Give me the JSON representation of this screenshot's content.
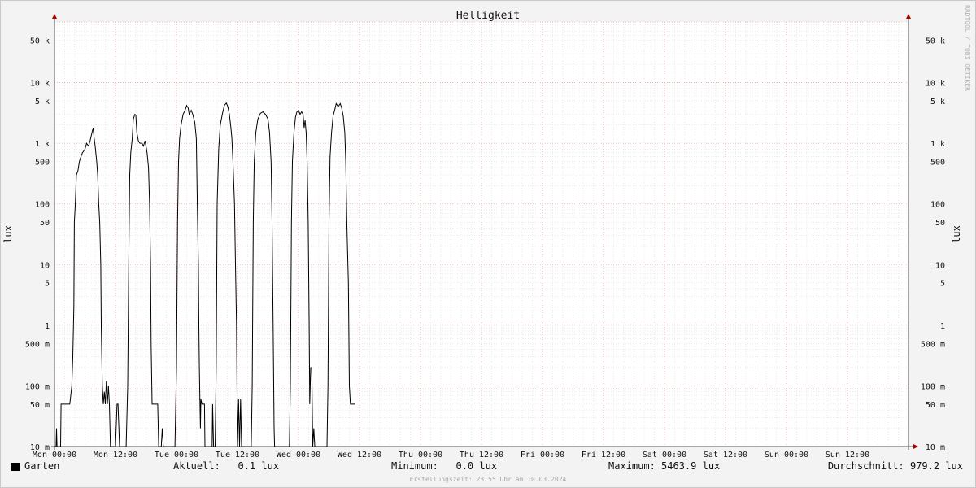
{
  "chart_data": {
    "type": "line",
    "title": "Helligkeit",
    "ylabel": "lux",
    "yscale": "log",
    "ylim": [
      0.01,
      100000
    ],
    "y_ticks": [
      {
        "value": 0.01,
        "label": "10 m"
      },
      {
        "value": 0.05,
        "label": "50 m"
      },
      {
        "value": 0.1,
        "label": "100 m"
      },
      {
        "value": 0.5,
        "label": "500 m"
      },
      {
        "value": 1,
        "label": "1"
      },
      {
        "value": 5,
        "label": "5"
      },
      {
        "value": 10,
        "label": "10"
      },
      {
        "value": 50,
        "label": "50"
      },
      {
        "value": 100,
        "label": "100"
      },
      {
        "value": 500,
        "label": "500"
      },
      {
        "value": 1000,
        "label": "1 k"
      },
      {
        "value": 5000,
        "label": "5 k"
      },
      {
        "value": 10000,
        "label": "10 k"
      },
      {
        "value": 50000,
        "label": "50 k"
      }
    ],
    "xlim_hours": [
      0,
      168
    ],
    "x_ticks": [
      {
        "hour": 0,
        "label": "Mon 00:00"
      },
      {
        "hour": 12,
        "label": "Mon 12:00"
      },
      {
        "hour": 24,
        "label": "Tue 00:00"
      },
      {
        "hour": 36,
        "label": "Tue 12:00"
      },
      {
        "hour": 48,
        "label": "Wed 00:00"
      },
      {
        "hour": 60,
        "label": "Wed 12:00"
      },
      {
        "hour": 72,
        "label": "Thu 00:00"
      },
      {
        "hour": 84,
        "label": "Thu 12:00"
      },
      {
        "hour": 96,
        "label": "Fri 00:00"
      },
      {
        "hour": 108,
        "label": "Fri 12:00"
      },
      {
        "hour": 120,
        "label": "Sat 00:00"
      },
      {
        "hour": 132,
        "label": "Sat 12:00"
      },
      {
        "hour": 144,
        "label": "Sun 00:00"
      },
      {
        "hour": 156,
        "label": "Sun 12:00"
      }
    ],
    "grid": true,
    "series": [
      {
        "name": "Garten",
        "color": "#000000",
        "points": [
          [
            0,
            0.01
          ],
          [
            0.3,
            0.01
          ],
          [
            0.4,
            0.02
          ],
          [
            0.5,
            0.01
          ],
          [
            1.2,
            0.01
          ],
          [
            1.3,
            0.05
          ],
          [
            3.0,
            0.05
          ],
          [
            3.2,
            0.07
          ],
          [
            3.4,
            0.1
          ],
          [
            3.6,
            0.3
          ],
          [
            3.8,
            2
          ],
          [
            3.9,
            50
          ],
          [
            4.1,
            100
          ],
          [
            4.3,
            300
          ],
          [
            4.6,
            350
          ],
          [
            4.9,
            500
          ],
          [
            5.2,
            600
          ],
          [
            5.5,
            700
          ],
          [
            6.0,
            800
          ],
          [
            6.3,
            1000
          ],
          [
            6.7,
            900
          ],
          [
            7.0,
            1100
          ],
          [
            7.3,
            1400
          ],
          [
            7.6,
            1800
          ],
          [
            7.8,
            1200
          ],
          [
            8.0,
            900
          ],
          [
            8.3,
            500
          ],
          [
            8.5,
            300
          ],
          [
            8.7,
            100
          ],
          [
            8.9,
            50
          ],
          [
            9.1,
            10
          ],
          [
            9.2,
            1
          ],
          [
            9.4,
            0.1
          ],
          [
            9.6,
            0.05
          ],
          [
            9.8,
            0.08
          ],
          [
            10.0,
            0.05
          ],
          [
            10.2,
            0.12
          ],
          [
            10.4,
            0.05
          ],
          [
            10.6,
            0.1
          ],
          [
            10.8,
            0.05
          ],
          [
            11.0,
            0.01
          ],
          [
            12.0,
            0.01
          ],
          [
            12.3,
            0.05
          ],
          [
            12.5,
            0.05
          ],
          [
            12.8,
            0.01
          ],
          [
            14.1,
            0.01
          ],
          [
            14.4,
            0.1
          ],
          [
            14.6,
            10
          ],
          [
            14.8,
            300
          ],
          [
            15.0,
            700
          ],
          [
            15.3,
            1200
          ],
          [
            15.5,
            2500
          ],
          [
            15.8,
            3000
          ],
          [
            16.0,
            2900
          ],
          [
            16.2,
            1500
          ],
          [
            16.5,
            1100
          ],
          [
            16.8,
            1000
          ],
          [
            17.2,
            1000
          ],
          [
            17.5,
            900
          ],
          [
            17.8,
            1100
          ],
          [
            18.0,
            900
          ],
          [
            18.2,
            700
          ],
          [
            18.5,
            400
          ],
          [
            18.7,
            100
          ],
          [
            18.9,
            10
          ],
          [
            19.0,
            0.5
          ],
          [
            19.2,
            0.05
          ],
          [
            20.3,
            0.05
          ],
          [
            20.5,
            0.01
          ],
          [
            21.0,
            0.01
          ],
          [
            21.2,
            0.02
          ],
          [
            21.4,
            0.01
          ],
          [
            23.7,
            0.01
          ],
          [
            24.0,
            0.2
          ],
          [
            24.2,
            50
          ],
          [
            24.4,
            500
          ],
          [
            24.6,
            1200
          ],
          [
            24.9,
            2000
          ],
          [
            25.3,
            3000
          ],
          [
            25.7,
            3500
          ],
          [
            26.0,
            4200
          ],
          [
            26.3,
            3800
          ],
          [
            26.5,
            3000
          ],
          [
            26.9,
            3500
          ],
          [
            27.2,
            3000
          ],
          [
            27.6,
            2200
          ],
          [
            27.9,
            1200
          ],
          [
            28.1,
            100
          ],
          [
            28.3,
            10
          ],
          [
            28.4,
            1
          ],
          [
            28.5,
            0.2
          ],
          [
            28.7,
            0.02
          ],
          [
            28.8,
            0.06
          ],
          [
            29.0,
            0.05
          ],
          [
            29.5,
            0.05
          ],
          [
            29.6,
            0.01
          ],
          [
            31.0,
            0.01
          ],
          [
            31.1,
            0.05
          ],
          [
            31.3,
            0.01
          ],
          [
            31.6,
            0.01
          ],
          [
            31.8,
            0.2
          ],
          [
            32.0,
            100
          ],
          [
            32.3,
            800
          ],
          [
            32.6,
            2000
          ],
          [
            33.0,
            3000
          ],
          [
            33.4,
            4200
          ],
          [
            33.8,
            4600
          ],
          [
            34.1,
            4000
          ],
          [
            34.4,
            3000
          ],
          [
            34.7,
            1800
          ],
          [
            34.9,
            1200
          ],
          [
            35.1,
            500
          ],
          [
            35.4,
            100
          ],
          [
            35.6,
            10
          ],
          [
            35.8,
            1
          ],
          [
            35.9,
            0.1
          ],
          [
            36.0,
            0.01
          ],
          [
            36.2,
            0.06
          ],
          [
            36.4,
            0.01
          ],
          [
            36.6,
            0.06
          ],
          [
            36.8,
            0.01
          ],
          [
            38.7,
            0.01
          ],
          [
            38.9,
            0.1
          ],
          [
            39.1,
            50
          ],
          [
            39.3,
            500
          ],
          [
            39.6,
            1500
          ],
          [
            40.0,
            2500
          ],
          [
            40.5,
            3100
          ],
          [
            41.0,
            3300
          ],
          [
            41.5,
            3000
          ],
          [
            42.0,
            2500
          ],
          [
            42.3,
            1500
          ],
          [
            42.6,
            500
          ],
          [
            42.8,
            50
          ],
          [
            43.0,
            1
          ],
          [
            43.2,
            0.02
          ],
          [
            43.3,
            0.01
          ],
          [
            46.2,
            0.01
          ],
          [
            46.4,
            0.1
          ],
          [
            46.6,
            50
          ],
          [
            46.8,
            500
          ],
          [
            47.1,
            1500
          ],
          [
            47.4,
            2700
          ],
          [
            47.7,
            3300
          ],
          [
            48.0,
            3500
          ],
          [
            48.3,
            3000
          ],
          [
            48.6,
            3300
          ],
          [
            48.9,
            3000
          ],
          [
            49.1,
            1800
          ],
          [
            49.3,
            2400
          ],
          [
            49.5,
            1500
          ],
          [
            49.7,
            500
          ],
          [
            49.9,
            50
          ],
          [
            50.1,
            1
          ],
          [
            50.2,
            0.05
          ],
          [
            50.4,
            0.2
          ],
          [
            50.6,
            0.2
          ],
          [
            50.8,
            0.01
          ],
          [
            51.0,
            0.02
          ],
          [
            51.2,
            0.01
          ],
          [
            53.6,
            0.01
          ],
          [
            53.8,
            0.1
          ],
          [
            54.0,
            50
          ],
          [
            54.2,
            600
          ],
          [
            54.5,
            1500
          ],
          [
            54.8,
            2800
          ],
          [
            55.1,
            3500
          ],
          [
            55.4,
            4500
          ],
          [
            55.8,
            4000
          ],
          [
            56.2,
            4500
          ],
          [
            56.5,
            3800
          ],
          [
            56.8,
            2800
          ],
          [
            57.1,
            1500
          ],
          [
            57.3,
            500
          ],
          [
            57.5,
            50
          ],
          [
            57.8,
            5
          ],
          [
            58.0,
            0.1
          ],
          [
            58.2,
            0.05
          ],
          [
            59.2,
            0.05
          ]
        ]
      }
    ]
  },
  "legend": {
    "series_name": "Garten",
    "current": "Aktuell:   0.1 lux",
    "minimum": "Minimum:   0.0 lux",
    "maximum": "Maximum: 5463.9 lux",
    "average": "Durchschnitt: 979.2 lux"
  },
  "footer": "Erstellungszeit: 23:55 Uhr am 10.03.2024",
  "watermark": "RRDTOOL / TOBI OETIKER"
}
